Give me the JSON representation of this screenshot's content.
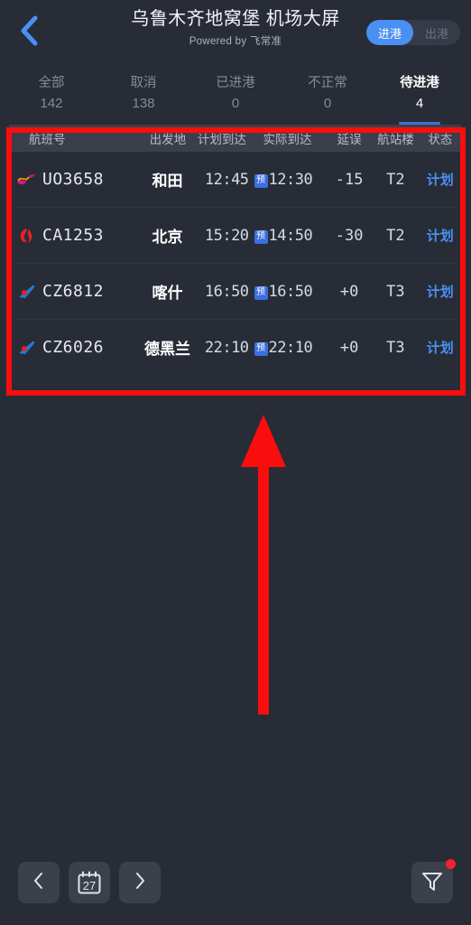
{
  "header": {
    "back_icon": "chevron-left-icon",
    "title": "乌鲁木齐地窝堡 机场大屏",
    "subtitle": "Powered by 飞常准",
    "segment": {
      "arrival_label": "进港",
      "departure_label": "出港",
      "active": "进港"
    },
    "accent_color": "#4a90f2"
  },
  "stats": [
    {
      "label": "全部",
      "value": "142",
      "active": false
    },
    {
      "label": "取消",
      "value": "138",
      "active": false
    },
    {
      "label": "已进港",
      "value": "0",
      "active": false
    },
    {
      "label": "不正常",
      "value": "0",
      "active": false
    },
    {
      "label": "待进港",
      "value": "4",
      "active": true
    }
  ],
  "table": {
    "columns": [
      "航班号",
      "出发地",
      "计划到达",
      "实际到达",
      "延误",
      "航站楼",
      "状态"
    ],
    "rows": [
      {
        "airline_logo": "hongkong-express-logo",
        "flight_no": "UO3658",
        "origin": "和田",
        "sta": "12:45",
        "ata_prefix": "预",
        "ata": "12:30",
        "delay": "-15",
        "terminal": "T2",
        "status": "计划"
      },
      {
        "airline_logo": "air-china-logo",
        "flight_no": "CA1253",
        "origin": "北京",
        "sta": "15:20",
        "ata_prefix": "预",
        "ata": "14:50",
        "delay": "-30",
        "terminal": "T2",
        "status": "计划"
      },
      {
        "airline_logo": "china-southern-logo",
        "flight_no": "CZ6812",
        "origin": "喀什",
        "sta": "16:50",
        "ata_prefix": "预",
        "ata": "16:50",
        "delay": "+0",
        "terminal": "T3",
        "status": "计划"
      },
      {
        "airline_logo": "china-southern-logo",
        "flight_no": "CZ6026",
        "origin": "德黑兰",
        "sta": "22:10",
        "ata_prefix": "预",
        "ata": "22:10",
        "delay": "+0",
        "terminal": "T3",
        "status": "计划"
      }
    ]
  },
  "bottom_bar": {
    "prev_day_icon": "chevron-left-icon",
    "calendar_icon": "calendar-icon",
    "calendar_day": "27",
    "next_day_icon": "chevron-right-icon",
    "filter_icon": "filter-icon",
    "filter_has_badge": true
  },
  "annotations": {
    "highlight_box_color": "#fb0d0d",
    "arrow_color": "#fb0d0d",
    "arrow_direction": "up"
  }
}
